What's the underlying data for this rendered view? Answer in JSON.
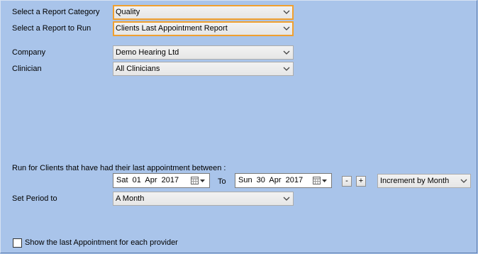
{
  "form": {
    "category_label": "Select a Report Category",
    "category_value": "Quality",
    "report_label": "Select a Report to Run",
    "report_value": "Clients Last Appointment Report",
    "company_label": "Company",
    "company_value": "Demo Hearing Ltd",
    "clinician_label": "Clinician",
    "clinician_value": "All Clinicians",
    "run_for_label": "Run for Clients that have had their last appointment between :",
    "from_date": "Sat  01  Apr  2017",
    "to_label": "To",
    "to_date": "Sun  30  Apr  2017",
    "minus_label": "-",
    "plus_label": "+",
    "increment_value": "Increment by Month",
    "set_period_label": "Set Period to",
    "period_value": "A Month",
    "show_last_label": "Show the last Appointment for each provider",
    "show_last_checked": false
  },
  "icons": {
    "dropdown": "chevron-down-icon",
    "calendar": "calendar-icon"
  },
  "colors": {
    "background": "#a9c4ea",
    "focus_border": "#f0a030"
  }
}
